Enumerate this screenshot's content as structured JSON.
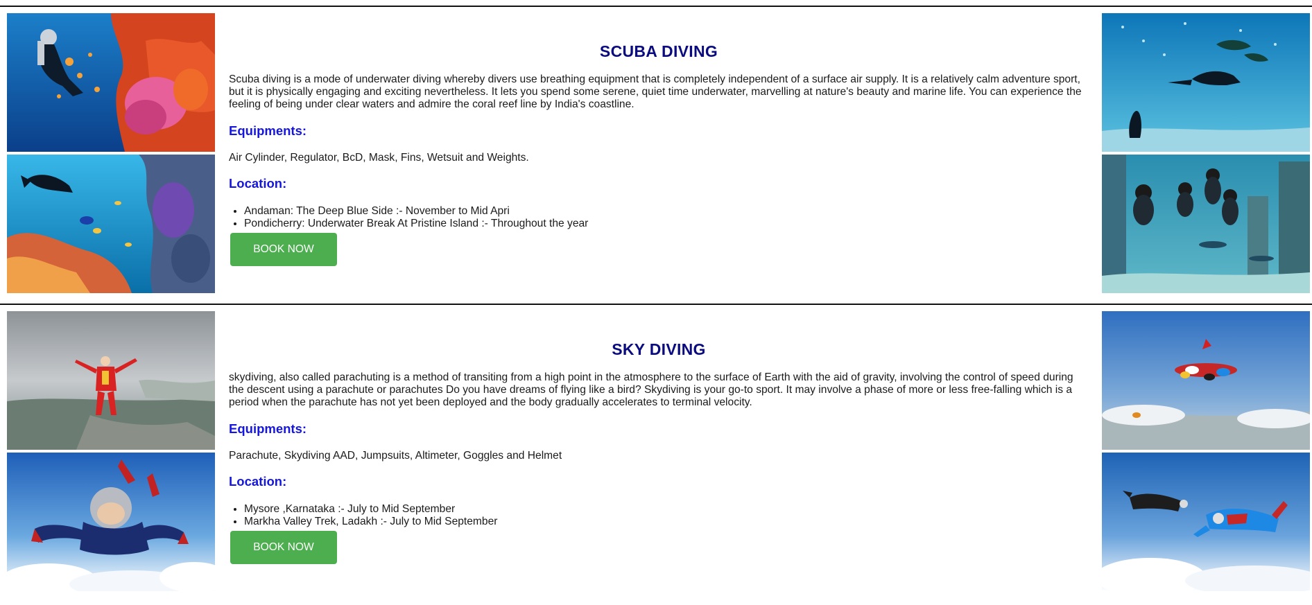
{
  "sections": [
    {
      "title": "SCUBA DIVING",
      "description": "Scuba diving is a mode of underwater diving whereby divers use breathing equipment that is completely independent of a surface air supply. It is a relatively calm adventure sport, but it is physically engaging and exciting nevertheless. It lets you spend some serene, quiet time underwater, marvelling at nature's beauty and marine life. You can experience the feeling of being under clear waters and admire the coral reef line by India's coastline.",
      "equipments_heading": "Equipments:",
      "equipments": "Air Cylinder, Regulator, BcD, Mask, Fins, Wetsuit and Weights.",
      "location_heading": "Location:",
      "locations": [
        "Andaman: The Deep Blue Side :- November to Mid Apri",
        "Pondicherry: Underwater Break At Pristine Island :- Throughout the year"
      ],
      "button_label": "BOOK NOW"
    },
    {
      "title": "SKY DIVING",
      "description": "skydiving, also called parachuting is a method of transiting from a high point in the atmosphere to the surface of Earth with the aid of gravity, involving the control of speed during the descent using a parachute or parachutes Do you have dreams of flying like a bird? Skydiving is your go-to sport. It may involve a phase of more or less free-falling which is a period when the parachute has not yet been deployed and the body gradually accelerates to terminal velocity.",
      "equipments_heading": "Equipments:",
      "equipments": "Parachute, Skydiving AAD, Jumpsuits, Altimeter, Goggles and Helmet",
      "location_heading": "Location:",
      "locations": [
        "Mysore ,Karnataka :- July to Mid September",
        "Markha Valley Trek, Ladakh :- July to Mid September"
      ],
      "button_label": "BOOK NOW"
    }
  ],
  "colors": {
    "title": "#0b0b80",
    "heading": "#1515e0",
    "button": "#4cae4f",
    "rule": "#111111"
  }
}
